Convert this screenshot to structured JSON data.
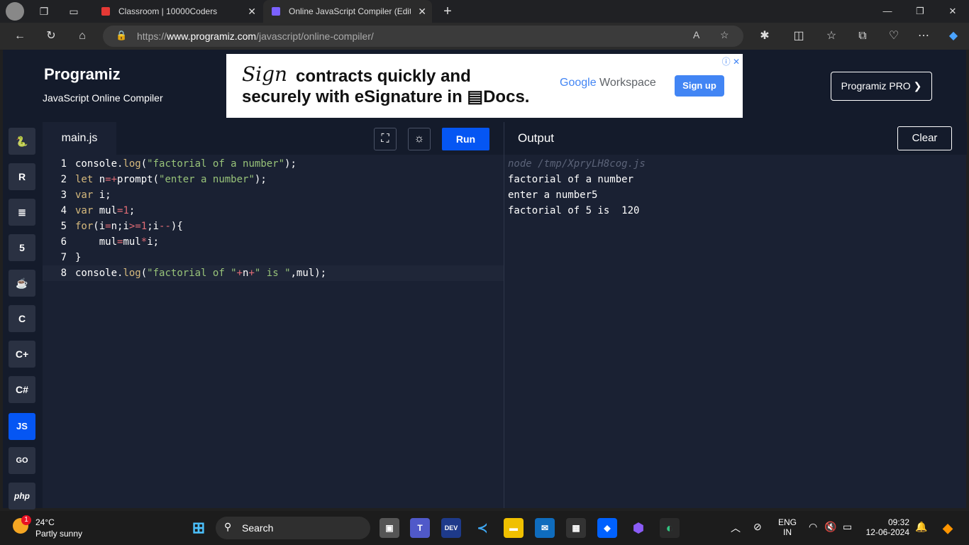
{
  "browser": {
    "tabs": [
      {
        "title": "Classroom | 10000Coders",
        "color": "#e53935"
      },
      {
        "title": "Online JavaScript Compiler (Edito",
        "color": "#7b61ff"
      }
    ],
    "url_prefix": "https://",
    "url_host": "www.programiz.com",
    "url_path": "/javascript/online-compiler/"
  },
  "header": {
    "logo": "Programiz",
    "subtitle": "JavaScript Online Compiler",
    "pro_button": "Programiz PRO ❯"
  },
  "ad": {
    "signature": "Sign",
    "line1": "contracts quickly and",
    "line2": "securely with eSignature in ▤Docs.",
    "brand_g": "Google",
    "brand_rest": " Workspace",
    "cta": "Sign up",
    "close": "ⓘ ✕"
  },
  "sidebar": {
    "langs": [
      "🐍",
      "R",
      "≣",
      "5",
      "☕",
      "C",
      "C+",
      "C#",
      "JS",
      "GO",
      "php"
    ],
    "active": "JS"
  },
  "editor": {
    "file_tab": "main.js",
    "run_label": "Run",
    "fullscreen_icon": "⛶",
    "theme_icon": "☼"
  },
  "code": [
    {
      "n": "1",
      "t": "console.log(\"factorial of a number\");"
    },
    {
      "n": "2",
      "t": "let n=+prompt(\"enter a number\");"
    },
    {
      "n": "3",
      "t": "var i;"
    },
    {
      "n": "4",
      "t": "var mul=1;"
    },
    {
      "n": "5",
      "t": "for(i=n;i>=1;i--){"
    },
    {
      "n": "6",
      "t": "    mul=mul*i;"
    },
    {
      "n": "7",
      "t": "}"
    },
    {
      "n": "8",
      "t": "console.log(\"factorial of \"+n+\" is \",mul);"
    }
  ],
  "output": {
    "title": "Output",
    "clear_label": "Clear",
    "lines": [
      "node /tmp/XpryLH8cog.js",
      "factorial of a number",
      "enter a number5",
      "factorial of 5 is  120"
    ]
  },
  "taskbar": {
    "temp": "24°C",
    "weather": "Partly sunny",
    "notif_count": "1",
    "search": "Search",
    "lang1": "ENG",
    "lang2": "IN",
    "time": "09:32",
    "date": "12-06-2024"
  }
}
